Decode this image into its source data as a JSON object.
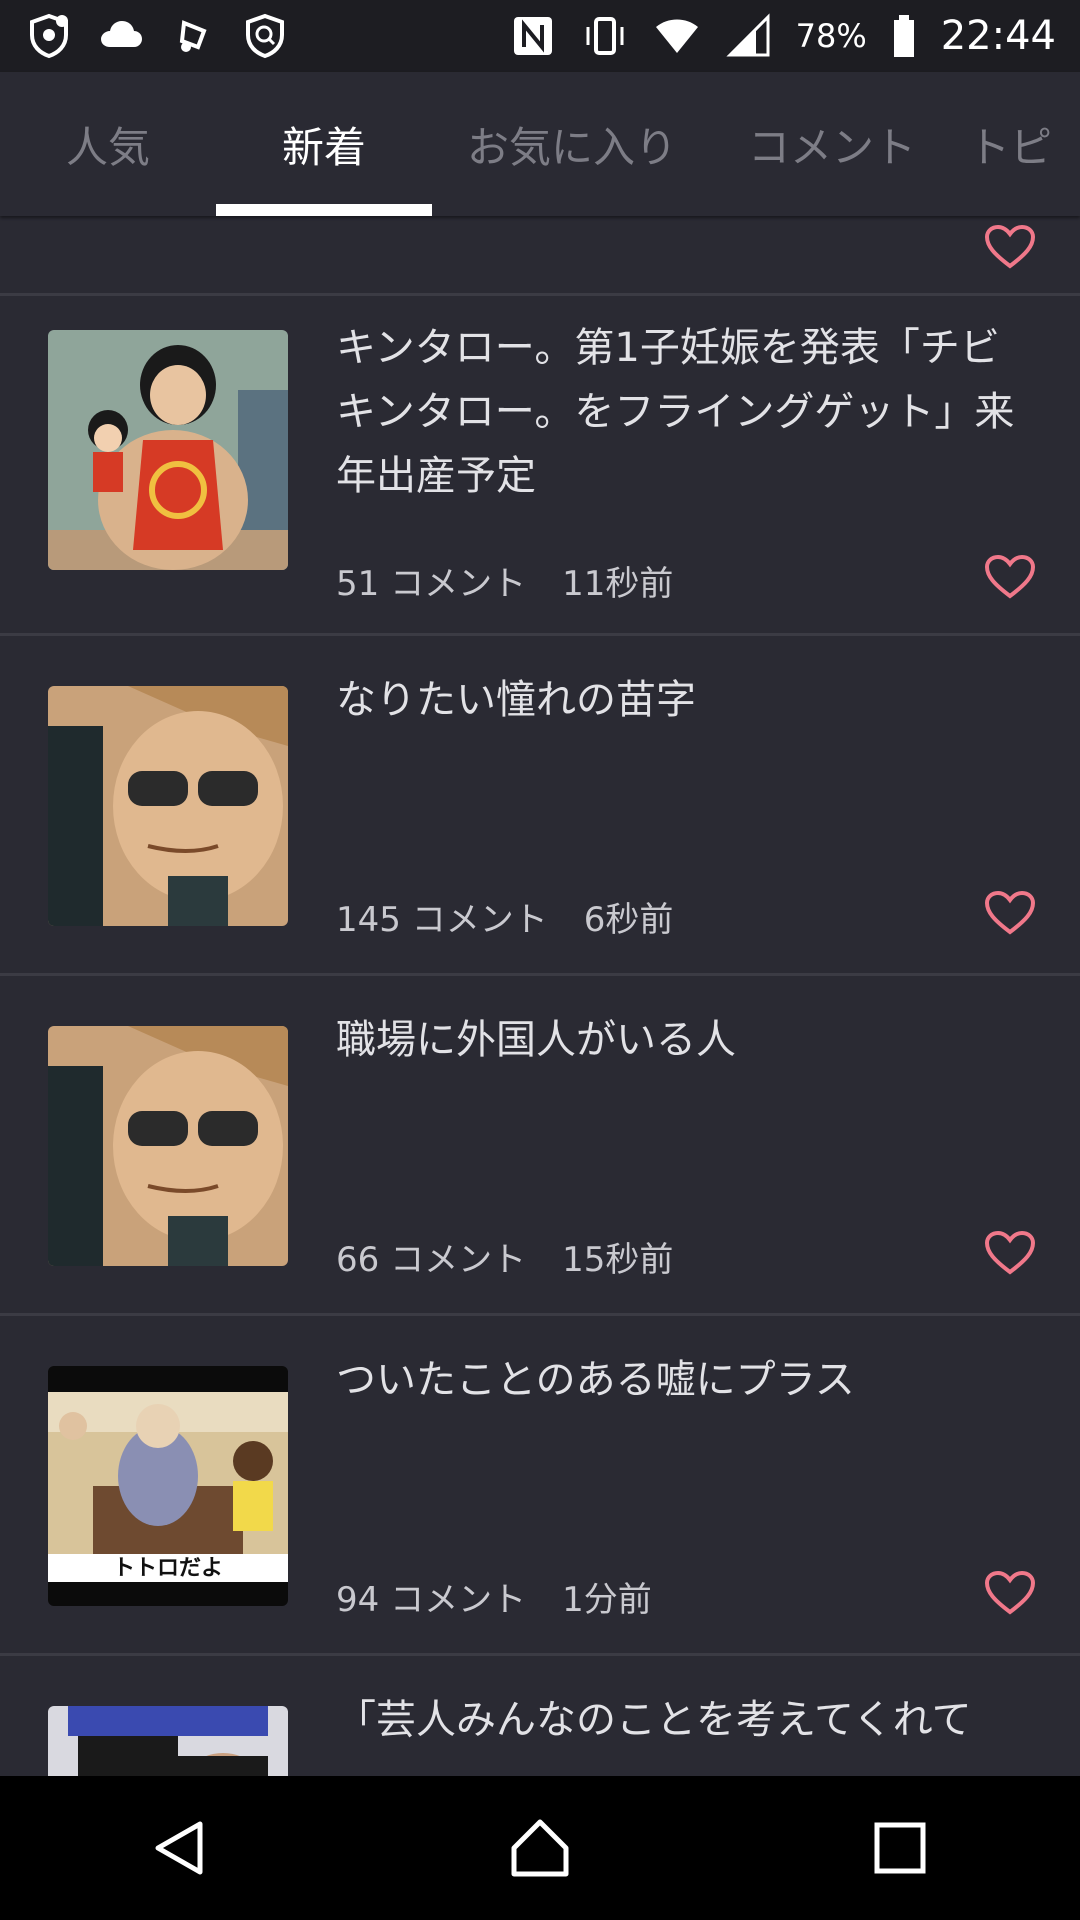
{
  "status_bar": {
    "battery_percent": "78%",
    "time": "22:44",
    "left_icons": [
      "shield-notification-icon",
      "cloud-icon",
      "music-icon",
      "security-app-icon"
    ],
    "right_icons": [
      "nfc-icon",
      "vibrate-icon",
      "wifi-icon",
      "cell-signal-icon",
      "battery-icon"
    ]
  },
  "tabs": [
    {
      "label": "人気",
      "active": false
    },
    {
      "label": "新着",
      "active": true
    },
    {
      "label": "お気に入り",
      "active": false
    },
    {
      "label": "コメント",
      "active": false
    },
    {
      "label": "トピ",
      "active": false
    }
  ],
  "items": [
    {
      "title": "キンタロー。第1子妊娠を発表「チビキンタロー。をフライングゲット」来年出産予定",
      "comments": "51 コメント",
      "time": "11秒前"
    },
    {
      "title": "なりたい憧れの苗字",
      "comments": "145 コメント",
      "time": "6秒前"
    },
    {
      "title": "職場に外国人がいる人",
      "comments": "66 コメント",
      "time": "15秒前"
    },
    {
      "title": "ついたことのある嘘にプラス",
      "comments": "94 コメント",
      "time": "1分前",
      "thumb_caption": "トトロだよ"
    },
    {
      "title": "「芸人みんなのことを考えてくれて"
    }
  ],
  "colors": {
    "background": "#2a2a33",
    "heart": "#f0788a",
    "divider": "#3b3b44"
  }
}
